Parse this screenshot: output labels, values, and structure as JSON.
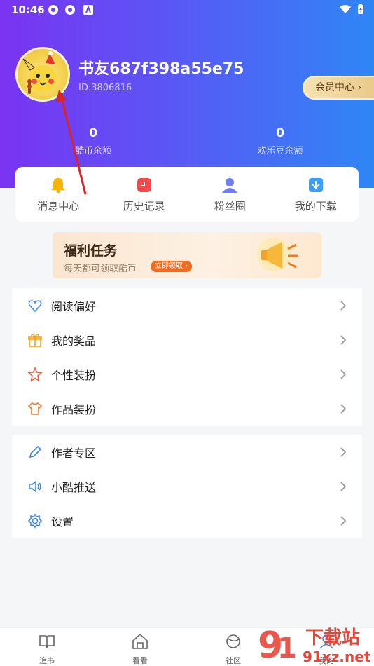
{
  "status_bar": {
    "time": "10:46"
  },
  "profile": {
    "username": "书友687f398a55e75",
    "user_id": "ID:3806816",
    "vip_label": "会员中心"
  },
  "stats": [
    {
      "value": "0",
      "label": "酷币余额"
    },
    {
      "value": "0",
      "label": "欢乐豆余额"
    }
  ],
  "quick_actions": [
    {
      "label": "消息中心",
      "icon": "bell-icon"
    },
    {
      "label": "历史记录",
      "icon": "history-icon"
    },
    {
      "label": "粉丝圈",
      "icon": "fans-icon"
    },
    {
      "label": "我的下载",
      "icon": "download-icon"
    }
  ],
  "welfare": {
    "title": "福利任务",
    "subtitle": "每天都可领取酷币",
    "button": "立即领取"
  },
  "menu_group_1": [
    {
      "label": "阅读偏好",
      "icon": "heart-icon"
    },
    {
      "label": "我的奖品",
      "icon": "gift-icon"
    },
    {
      "label": "个性装扮",
      "icon": "star-icon"
    },
    {
      "label": "作品装扮",
      "icon": "shirt-icon"
    }
  ],
  "menu_group_2": [
    {
      "label": "作者专区",
      "icon": "pen-icon"
    },
    {
      "label": "小酷推送",
      "icon": "speaker-icon"
    },
    {
      "label": "设置",
      "icon": "gear-icon"
    }
  ],
  "bottom_nav": [
    {
      "label": "追书",
      "icon": "book-icon"
    },
    {
      "label": "看看",
      "icon": "home-icon"
    },
    {
      "label": "社区",
      "icon": "community-icon"
    },
    {
      "label": "我的",
      "icon": "profile-icon"
    }
  ],
  "watermark": {
    "text_top": "下载站",
    "text_bottom": "91xz.net"
  },
  "colors": {
    "header_start": "#7a33f2",
    "header_end": "#2f86f5",
    "accent_blue": "#3a86f0",
    "annotation_red": "#d8242a"
  }
}
